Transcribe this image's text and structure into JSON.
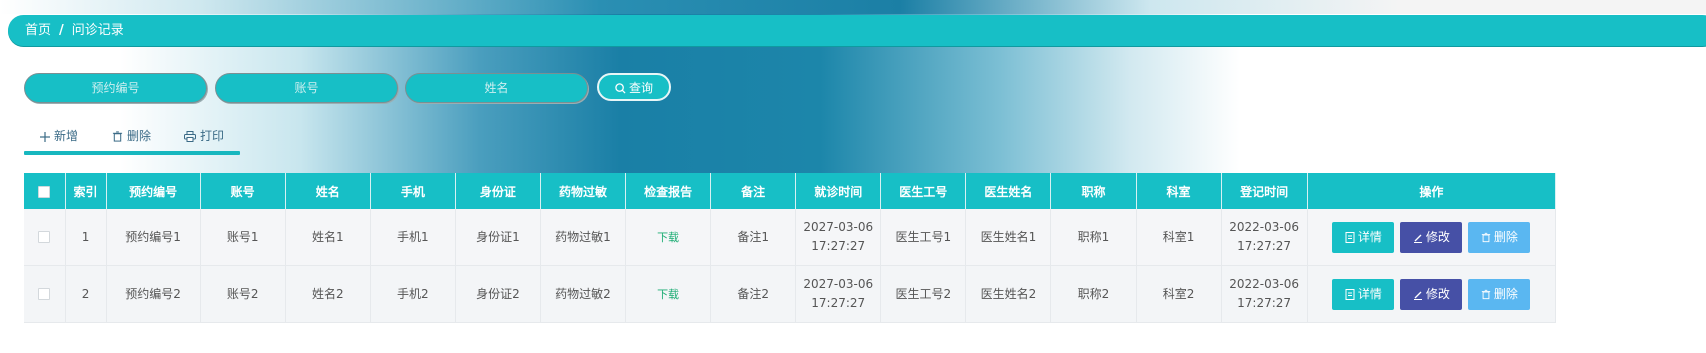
{
  "breadcrumb": {
    "home": "首页",
    "separator": "/",
    "current": "问诊记录"
  },
  "search": {
    "appointment_placeholder": "预约编号",
    "account_placeholder": "账号",
    "name_placeholder": "姓名",
    "button_label": "查询"
  },
  "actions": {
    "add": "新增",
    "delete": "删除",
    "print": "打印"
  },
  "table": {
    "headers": [
      "索引",
      "预约编号",
      "账号",
      "姓名",
      "手机",
      "身份证",
      "药物过敏",
      "检查报告",
      "备注",
      "就诊时间",
      "医生工号",
      "医生姓名",
      "职称",
      "科室",
      "登记时间",
      "操作"
    ],
    "rows": [
      {
        "index": "1",
        "appointment_no": "预约编号1",
        "account": "账号1",
        "name": "姓名1",
        "phone": "手机1",
        "id_card": "身份证1",
        "allergy": "药物过敏1",
        "report": "下载",
        "remark": "备注1",
        "visit_date": "2027-03-06",
        "visit_time": "17:27:27",
        "doctor_no": "医生工号1",
        "doctor_name": "医生姓名1",
        "title": "职称1",
        "dept": "科室1",
        "reg_date": "2022-03-06",
        "reg_time": "17:27:27"
      },
      {
        "index": "2",
        "appointment_no": "预约编号2",
        "account": "账号2",
        "name": "姓名2",
        "phone": "手机2",
        "id_card": "身份证2",
        "allergy": "药物过敏2",
        "report": "下载",
        "remark": "备注2",
        "visit_date": "2027-03-06",
        "visit_time": "17:27:27",
        "doctor_no": "医生工号2",
        "doctor_name": "医生姓名2",
        "title": "职称2",
        "dept": "科室2",
        "reg_date": "2022-03-06",
        "reg_time": "17:27:27"
      }
    ],
    "row_buttons": {
      "detail": "详情",
      "edit": "修改",
      "delete": "删除"
    }
  },
  "colors": {
    "accent": "#17bfc6",
    "edit": "#4650a6",
    "delete": "#5ab7f1",
    "download": "#1dad74"
  },
  "icons": [
    "search-icon",
    "plus-icon",
    "trash-icon",
    "printer-icon",
    "document-icon",
    "pencil-icon"
  ]
}
